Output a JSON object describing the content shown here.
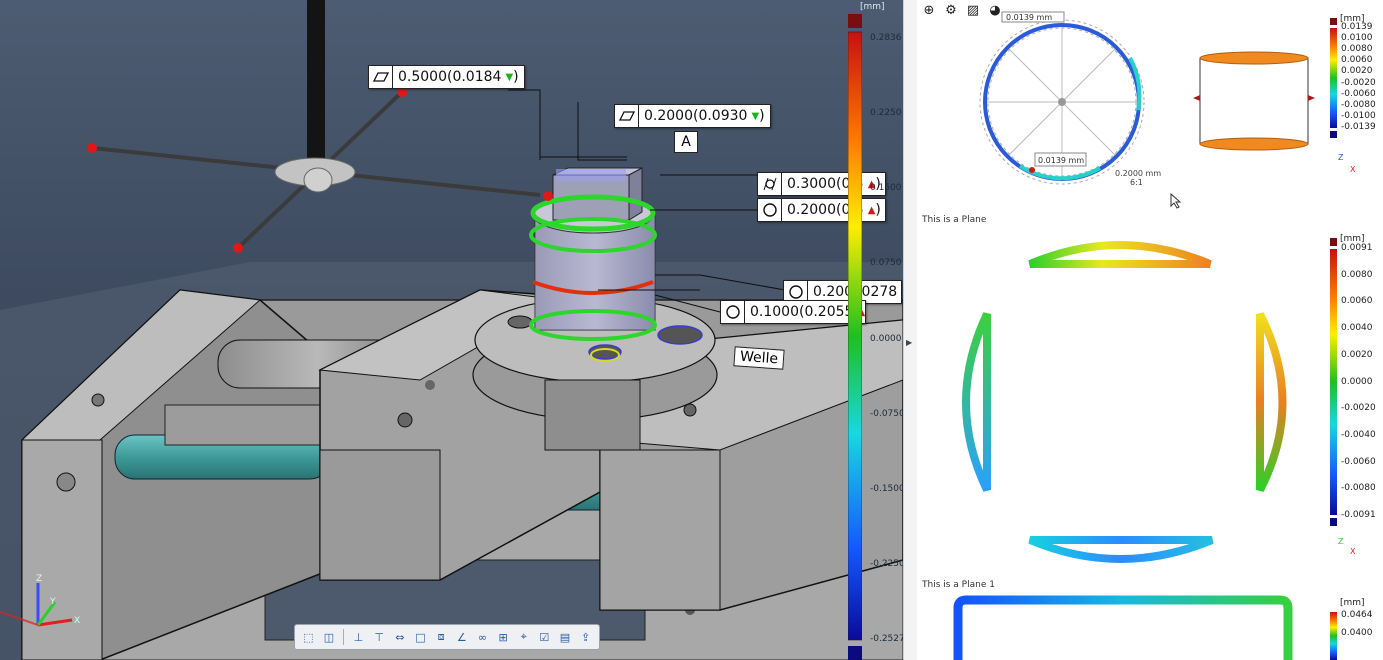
{
  "viewport": {
    "scale": {
      "unit": "[mm]",
      "ticks": [
        "0.2836",
        "0.2250",
        "0.1500",
        "0.0750",
        "0.0000",
        "-0.0750",
        "-0.1500",
        "-0.2250",
        "-0.2527"
      ]
    },
    "callouts": {
      "flatness_1": {
        "value": "0.5000(0.0184",
        "status": "▼"
      },
      "flatness_2": {
        "value": "0.2000(0.0930",
        "status": "▼"
      },
      "datum": "A",
      "cylindricity": {
        "value": "0.3000(0.5",
        "status": "▲"
      },
      "roundness_1": {
        "value": "0.2000(0.5",
        "status": "▲"
      },
      "roundness_2": {
        "value": "0.200",
        "tail": ".0278"
      },
      "roundness_3": {
        "value": "0.1000(0.2055",
        "status": "▲"
      },
      "part_label": "Welle"
    },
    "axes": {
      "z": "Z",
      "x": "X",
      "y": "Y"
    },
    "toolbar": [
      "select-box-icon",
      "split-view-icon",
      "align-icon",
      "align-axis-icon",
      "measure-icon",
      "frame-icon",
      "frame-fit-icon",
      "angle-icon",
      "link-icon",
      "grid-icon",
      "crosshair-icon",
      "check-icon",
      "report-icon",
      "export-icon"
    ]
  },
  "panel": {
    "tools": [
      "globe-icon",
      "settings-icon",
      "image-icon",
      "pie-chart-icon"
    ],
    "circle_plot": {
      "top_label": "0.0139 mm",
      "inner_label": "0.0139 mm",
      "scale_text": "0.2000 mm",
      "ratio": "6:1"
    },
    "scale_1": {
      "unit": "[mm]",
      "ticks": [
        "0.0139",
        "0.0100",
        "0.0080",
        "0.0060",
        "0.0020",
        "-0.0020",
        "-0.0060",
        "-0.0080",
        "-0.0100",
        "-0.0139"
      ]
    },
    "sections": [
      {
        "label": "This is a Plane"
      },
      {
        "label": "This is a Plane 1"
      }
    ],
    "scale_2": {
      "unit": "[mm]",
      "ticks": [
        "0.0091",
        "0.0080",
        "0.0060",
        "0.0040",
        "0.0020",
        "0.0000",
        "-0.0020",
        "-0.0040",
        "-0.0060",
        "-0.0080",
        "-0.0091"
      ]
    },
    "scale_3": {
      "unit": "[mm]",
      "ticks": [
        "0.0464",
        "0.0400"
      ]
    },
    "mini_axes": {
      "z": "Z",
      "x": "X"
    }
  },
  "colors": {
    "scale_top": "#8a1010",
    "scale_bottom": "#10108a",
    "accent_blue": "#2a5aa8"
  }
}
